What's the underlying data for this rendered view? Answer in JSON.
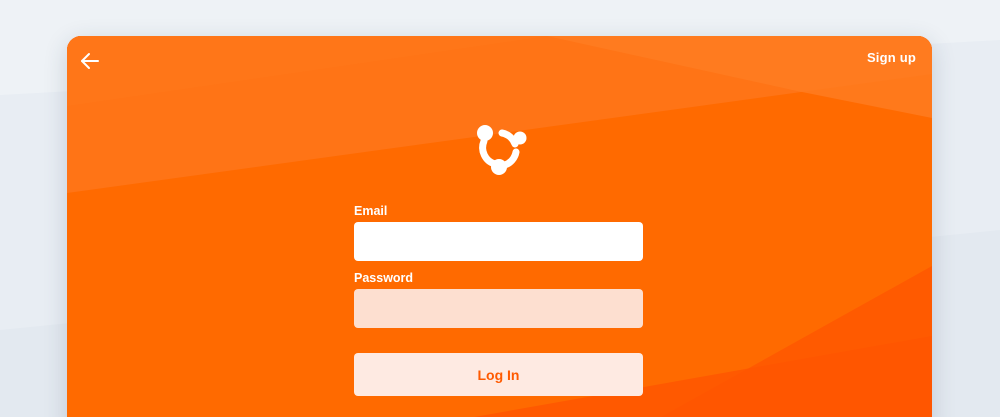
{
  "header": {
    "back_icon": "arrow-left-icon",
    "signup_label": "Sign up"
  },
  "logo": {
    "icon": "people-circle-logo-icon"
  },
  "form": {
    "email_label": "Email",
    "email_value": "",
    "email_placeholder": "",
    "password_label": "Password",
    "password_value": "",
    "password_placeholder": "",
    "login_label": "Log In"
  },
  "colors": {
    "brand_orange": "#ff6a00",
    "page_background": "#e8edf3",
    "login_text": "#ff5a00",
    "password_field_bg": "#fddfd0",
    "login_button_bg": "#feeae2"
  }
}
